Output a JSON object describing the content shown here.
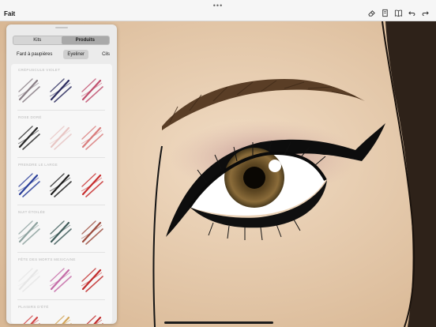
{
  "toolbar": {
    "dots": "•••",
    "done_label": "Fait",
    "icons": [
      "eraser-icon",
      "bookmark-icon",
      "book-icon",
      "undo-icon",
      "redo-icon"
    ]
  },
  "panel": {
    "segments": [
      "Kits",
      "Produits"
    ],
    "active_segment": "Produits",
    "tabs": [
      "Fard à paupières",
      "Eyeliner",
      "Cils"
    ],
    "active_tab": "Eyeliner",
    "kits": [
      {
        "title": "CRÉPUSCULE VIOLET",
        "colors": [
          "#8a7f86",
          "#2c2c5e",
          "#c0506e"
        ]
      },
      {
        "title": "ROSE DORÉ",
        "colors": [
          "#2a2a2a",
          "#e8c6c4",
          "#d97c7c"
        ]
      },
      {
        "title": "PRENDRE LE LARGE",
        "colors": [
          "#2a3f9a",
          "#1c1c1c",
          "#c82f2f"
        ]
      },
      {
        "title": "NUIT ÉTOILÉE",
        "colors": [
          "#8fa3a0",
          "#3f5c5a",
          "#9c4d3f"
        ]
      },
      {
        "title": "FÊTE DES MORTS MEXICAINE",
        "colors": [
          "#e6e6e6",
          "#c56da8",
          "#c12b2b"
        ]
      },
      {
        "title": "PLAISIRS D’ÉTÉ",
        "colors": [
          "#d24a4a",
          "#d4a65a",
          "#c12b2b"
        ]
      }
    ]
  },
  "canvas": {
    "skin": "#e9d1b6",
    "iris": "#7d5f33"
  }
}
